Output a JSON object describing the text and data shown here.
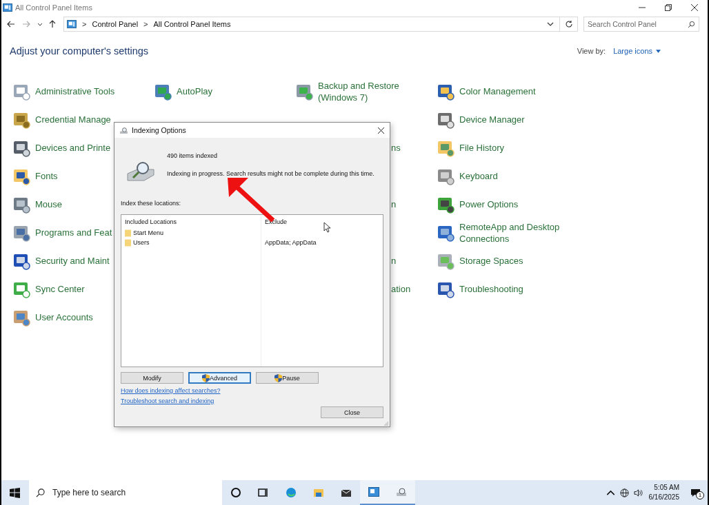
{
  "window": {
    "title": "All Control Panel Items"
  },
  "address_bar": {
    "breadcrumbs": [
      "Control Panel",
      "All Control Panel Items"
    ],
    "separator": ">"
  },
  "search": {
    "placeholder": "Search Control Panel"
  },
  "heading": "Adjust your computer's settings",
  "view_by": {
    "label": "View by:",
    "value": "Large icons"
  },
  "rows": [
    {
      "items": [
        {
          "kind": "full",
          "label": "Administrative Tools"
        },
        {
          "kind": "full",
          "label": "AutoPlay"
        },
        {
          "kind": "full",
          "label": "Backup and Restore (Windows 7)"
        },
        {
          "kind": "full",
          "label": "Color Management"
        }
      ]
    },
    {
      "items": [
        {
          "kind": "full",
          "label": "Credential Manage"
        },
        {
          "kind": "full",
          "label": "Device Manager"
        }
      ]
    },
    {
      "items": [
        {
          "kind": "full",
          "label": "Devices and Printe"
        },
        {
          "kind": "partial",
          "label": "ns"
        },
        {
          "kind": "full",
          "label": "File History"
        }
      ]
    },
    {
      "items": [
        {
          "kind": "full",
          "label": "Fonts"
        },
        {
          "kind": "full",
          "label": "Keyboard"
        }
      ]
    },
    {
      "items": [
        {
          "kind": "full",
          "label": "Mouse"
        },
        {
          "kind": "partial",
          "label": "n"
        },
        {
          "kind": "full",
          "label": "Power Options"
        }
      ]
    },
    {
      "items": [
        {
          "kind": "full",
          "label": "Programs and Feat"
        },
        {
          "kind": "full",
          "label": "RemoteApp and Desktop Connections"
        }
      ]
    },
    {
      "items": [
        {
          "kind": "full",
          "label": "Security and Maint"
        },
        {
          "kind": "partial",
          "label": "n"
        },
        {
          "kind": "full",
          "label": "Storage Spaces"
        }
      ]
    },
    {
      "items": [
        {
          "kind": "full",
          "label": "Sync Center"
        },
        {
          "kind": "partial",
          "label": "ation"
        },
        {
          "kind": "full",
          "label": "Troubleshooting"
        }
      ]
    },
    {
      "items": [
        {
          "kind": "full",
          "label": "User Accounts"
        }
      ]
    }
  ],
  "dialog": {
    "title": "Indexing Options",
    "count": "490 items indexed",
    "status": "Indexing in progress. Search results might not be complete during this time.",
    "locations_label": "Index these locations:",
    "columns": [
      "Included Locations",
      "Exclude"
    ],
    "locations": [
      {
        "name": "Start Menu"
      },
      {
        "name": "Users",
        "exclude": "AppData; AppData"
      }
    ],
    "buttons": [
      {
        "label": "Modify",
        "shield": false,
        "focused": false
      },
      {
        "label": "Advanced",
        "shield": true,
        "focused": true
      },
      {
        "label": "Pause",
        "shield": true,
        "focused": false
      }
    ],
    "links": [
      "How does indexing affect searches?",
      "Troubleshoot search and indexing"
    ],
    "close_button": "Close"
  },
  "taskbar": {
    "search_placeholder": "Type here to search",
    "apps": [
      {
        "selected": false
      },
      {
        "selected": false
      },
      {
        "selected": false
      },
      {
        "selected": false
      },
      {
        "selected": false
      },
      {
        "selected": true
      },
      {
        "selected": true
      }
    ],
    "time": "5:05 AM",
    "date": "6/16/2025",
    "notification_count": "1"
  }
}
